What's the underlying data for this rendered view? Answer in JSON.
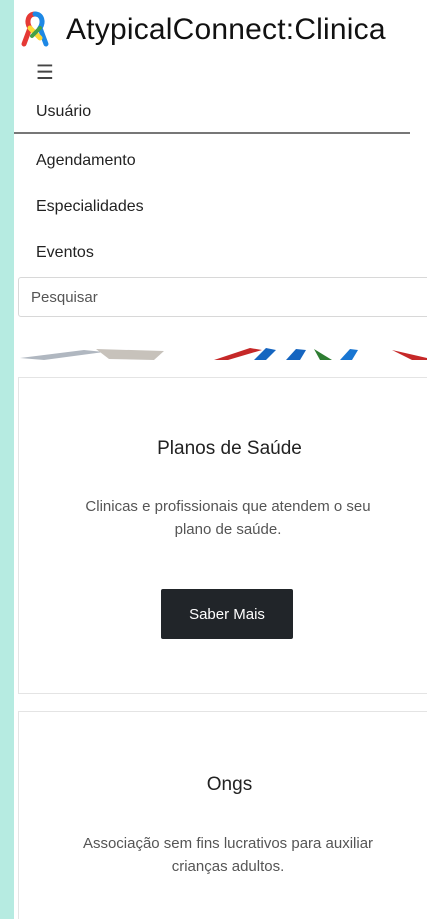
{
  "header": {
    "brand": "AtypicalConnect:Clinica",
    "menu_icon": "☰"
  },
  "nav": {
    "items": [
      {
        "label": "Usuário",
        "active": true
      },
      {
        "label": "Agendamento"
      },
      {
        "label": "Especialidades"
      },
      {
        "label": "Eventos"
      }
    ]
  },
  "search": {
    "placeholder": "Pesquisar"
  },
  "cards": [
    {
      "title": "Planos de Saúde",
      "text": "Clinicas e profissionais que atendem o seu plano de saúde.",
      "button": "Saber Mais"
    },
    {
      "title": "Ongs",
      "text": "Associação sem fins lucrativos para auxiliar crianças adultos."
    }
  ],
  "colors": {
    "outer_background": "#b6ebe1",
    "button_background": "#212529",
    "button_text": "#ffffff"
  }
}
